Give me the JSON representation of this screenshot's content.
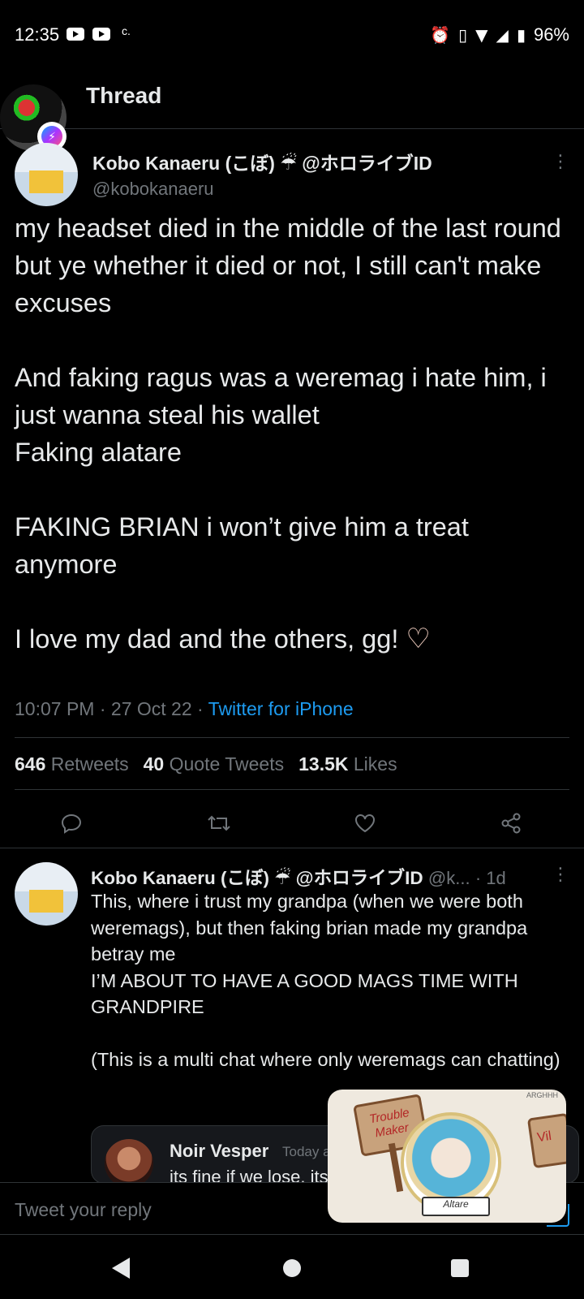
{
  "status_bar": {
    "time": "12:35",
    "extra": "c.",
    "battery": "96%"
  },
  "header": {
    "title": "Thread"
  },
  "main_tweet": {
    "name": "Kobo Kanaeru (こぼ) ☔ @ホロライブID",
    "handle": "@kobokanaeru",
    "text": "my headset died in the middle of the last round\nbut ye whether it died or not, I still can't make excuses\n\nAnd faking ragus was a weremag i hate him, i just wanna steal his wallet\nFaking alatare\n\nFAKING BRIAN i won’t give him a treat anymore\n\nI love my dad and the others, gg!",
    "time": "10:07 PM",
    "date": "27 Oct 22",
    "source": "Twitter for iPhone",
    "stats": {
      "retweets_count": "646",
      "retweets_label": "Retweets",
      "quotes_count": "40",
      "quotes_label": "Quote Tweets",
      "likes_count": "13.5K",
      "likes_label": "Likes"
    }
  },
  "reply_tweet": {
    "name": "Kobo Kanaeru (こぼ) ☔ @ホロライブID",
    "handle": "@k...",
    "age": "· 1d",
    "text": "This, where i trust my grandpa (when we were both weremags), but then faking brian made my grandpa betray me\nI’M ABOUT TO HAVE A GOOD MAGS TIME WITH GRANDPIRE\n\n(This is a multi chat where only weremags can chatting)",
    "quote": {
      "name": "Noir Vesper",
      "time": "Today a",
      "text": "its fine if we lose, its"
    }
  },
  "reply_box": {
    "placeholder": "Tweet your reply"
  },
  "pip": {
    "sign_text": "Trouble Maker",
    "ribbon_text": "Altare",
    "side_sign": "Vil",
    "corner_tag": "ARGHHH"
  },
  "icons": [
    "youtube-icon",
    "alarm-icon",
    "vibrate-icon",
    "wifi-icon",
    "signal-icon",
    "battery-icon",
    "reply-icon",
    "retweet-icon",
    "like-icon",
    "share-icon",
    "back-icon",
    "home-icon",
    "recents-icon",
    "more-icon"
  ]
}
